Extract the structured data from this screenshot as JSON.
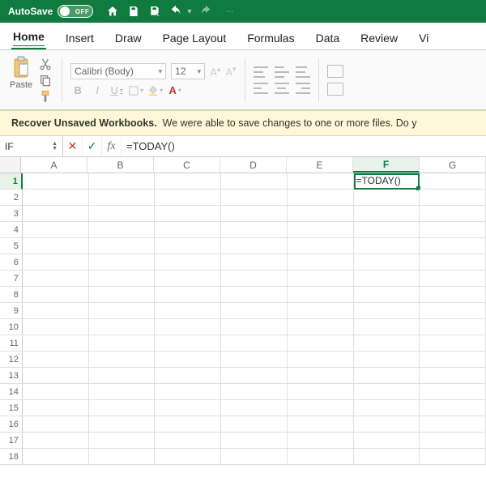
{
  "titlebar": {
    "autosave_label": "AutoSave",
    "toggle_state": "OFF"
  },
  "tabs": [
    "Home",
    "Insert",
    "Draw",
    "Page Layout",
    "Formulas",
    "Data",
    "Review",
    "Vi"
  ],
  "active_tab": "Home",
  "ribbon": {
    "paste_label": "Paste",
    "font_name": "Calibri (Body)",
    "font_size": "12",
    "bold": "B",
    "italic": "I",
    "underline": "U"
  },
  "recover": {
    "title": "Recover Unsaved Workbooks.",
    "msg": "We were able to save changes to one or more files. Do y"
  },
  "formula_bar": {
    "name_box": "IF",
    "formula": "=TODAY()"
  },
  "grid": {
    "columns": [
      "A",
      "B",
      "C",
      "D",
      "E",
      "F",
      "G"
    ],
    "active_col_index": 5,
    "rows": 18,
    "active_row": 1,
    "active_cell_value": "=TODAY()"
  }
}
